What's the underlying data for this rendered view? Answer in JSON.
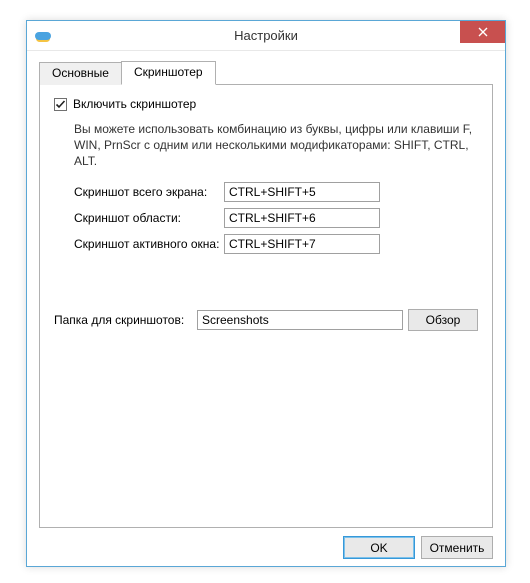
{
  "window": {
    "title": "Настройки"
  },
  "tabs": {
    "general": "Основные",
    "screenshoter": "Скриншотер"
  },
  "panel": {
    "enable_label": "Включить скриншотер",
    "enable_checked": true,
    "hint": "Вы можете использовать комбинацию из буквы, цифры или клавиши F, WIN, PrnScr с одним или несколькими модификаторами: SHIFT, CTRL, ALT.",
    "fullscreen_label": "Скриншот всего экрана:",
    "fullscreen_value": "CTRL+SHIFT+5",
    "area_label": "Скриншот области:",
    "area_value": "CTRL+SHIFT+6",
    "active_label": "Скриншот активного окна:",
    "active_value": "CTRL+SHIFT+7",
    "folder_label": "Папка для скриншотов:",
    "folder_value": "Screenshots",
    "browse_label": "Обзор"
  },
  "footer": {
    "ok": "OK",
    "cancel": "Отменить"
  }
}
